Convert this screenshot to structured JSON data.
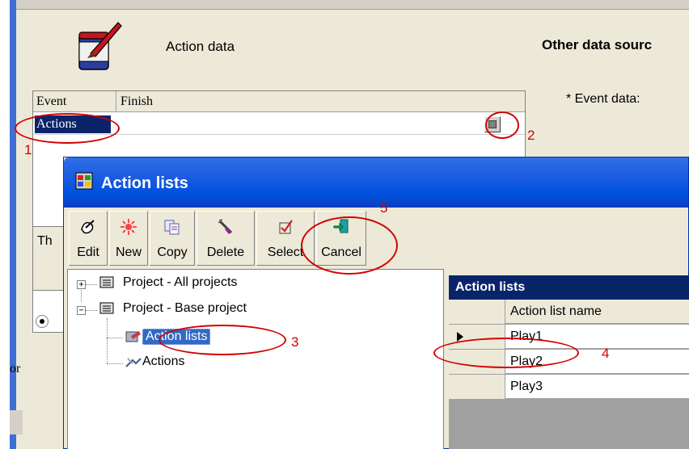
{
  "background": {
    "action_data_label": "Action data",
    "other_data_label": "Other data sourc",
    "event_data_label": "* Event data:",
    "grid": {
      "columns": [
        "Event",
        "Finish"
      ],
      "selected_cell": "Actions"
    },
    "side_panel_text": "Th",
    "partial_text": "or"
  },
  "dialog": {
    "title": "Action lists",
    "toolbar": [
      {
        "label": "Edit",
        "icon": "edit-icon"
      },
      {
        "label": "New",
        "icon": "new-icon"
      },
      {
        "label": "Copy",
        "icon": "copy-icon"
      },
      {
        "label": "Delete",
        "icon": "delete-icon"
      },
      {
        "label": "Select",
        "icon": "select-icon"
      },
      {
        "label": "Cancel",
        "icon": "cancel-icon"
      }
    ],
    "tree": {
      "items": [
        {
          "label": "Project - All projects",
          "icon": "project-icon",
          "expander": "+"
        },
        {
          "label": "Project - Base project",
          "icon": "project-icon",
          "expander": "−"
        },
        {
          "label": "Action lists",
          "icon": "action-lists-icon"
        },
        {
          "label": "Actions",
          "icon": "actions-icon"
        }
      ]
    },
    "list": {
      "title": "Action lists",
      "column_header": "Action list name",
      "rows": [
        "Play1",
        "Play2",
        "Play3"
      ]
    }
  },
  "annotations": [
    "1",
    "2",
    "3",
    "4",
    "5"
  ],
  "colors": {
    "annotation": "#d20000",
    "title_bar": "#0052e0",
    "selection": "#0a246a"
  }
}
